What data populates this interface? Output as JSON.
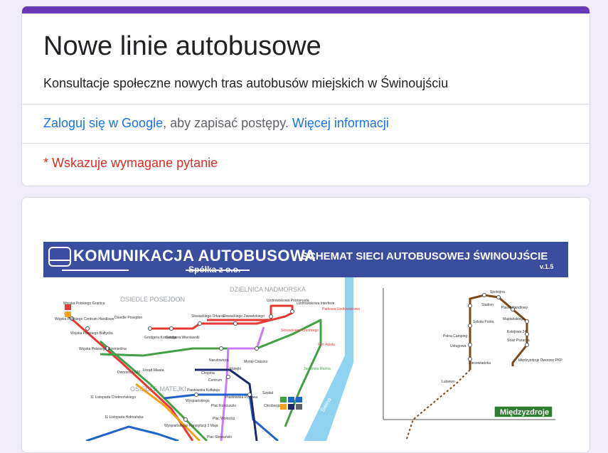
{
  "colors": {
    "accent": "#673ab7",
    "link": "#1a73e8",
    "required": "#d93025",
    "banner": "#3a4ea0"
  },
  "form": {
    "title": "Nowe linie autobusowe",
    "description": "Konsultacje społeczne nowych tras autobusów miejskich w Świnoujściu"
  },
  "signin": {
    "link_label": "Zaloguj się w Google",
    "middle_text": ", aby zapisać postępy. ",
    "more_link_label": "Więcej informacji"
  },
  "required_note": "* Wskazuje wymagane pytanie",
  "map": {
    "company_name": "KOMUNIKACJA AUTOBUSOWA",
    "company_suffix": "Spółka z o.o.",
    "scheme_title": "SCHEMAT SIECI AUTOBUSOWEJ ŚWINOUJŚCIE",
    "version": "v.1.5",
    "district_1": "OSIEDLE POSEJDON",
    "district_2": "DZIELNICA NADMORSKA",
    "district_3": "OSIEDLE MATEJKI",
    "river": "Świna",
    "badge": "Międzyzdroje",
    "stops_left": [
      "Wojska Polskiego Granica",
      "Wojska Polskiego Centrum Handlowe",
      "Wojska Polskiego Bałtycka",
      "Wojska Polskiego Rzemieślna",
      "Osiedle Posejdon",
      "Grottgera Kossaków",
      "Grottgera Wieniawski",
      "Słowackiego Orkana",
      "Słowackiego Zawadzkiego",
      "Uzdrowiskowa Promenada",
      "Uzdrowiskowa Interferie",
      "Parkowa Uzdrowiskowa",
      "Słowackiego Chrobrego",
      "Fort Anioła",
      "Narutowicza",
      "Chopina",
      "Matejki",
      "Dworzec USM",
      "Urząd Miasta",
      "11 Listopada Chełmońskiego",
      "11 Listopada Hołmańska",
      "Plac Kościuszki",
      "Centrum",
      "Piastowska Kołłątaja",
      "Szpital",
      "Wyspiańskiego",
      "Monte Cassino",
      "Wyspiańskiego Konstytucji 3 Maja",
      "Chrobrego",
      "Plac Wolności",
      "Piastowska Portowa",
      "Jachtowa Marina",
      "Plac Słowiański"
    ],
    "stops_right": [
      "Spokojna",
      "Paweł Handlowy",
      "Stadion",
      "Majdańskiego",
      "Kolejowa 24",
      "Straż Pożarna",
      "Szkoła Polna",
      "Polna Camping",
      "Ustugowa",
      "Międzyzdroje Dworzec PKP",
      "Niecewiadzka",
      "Lubiewo"
    ]
  }
}
